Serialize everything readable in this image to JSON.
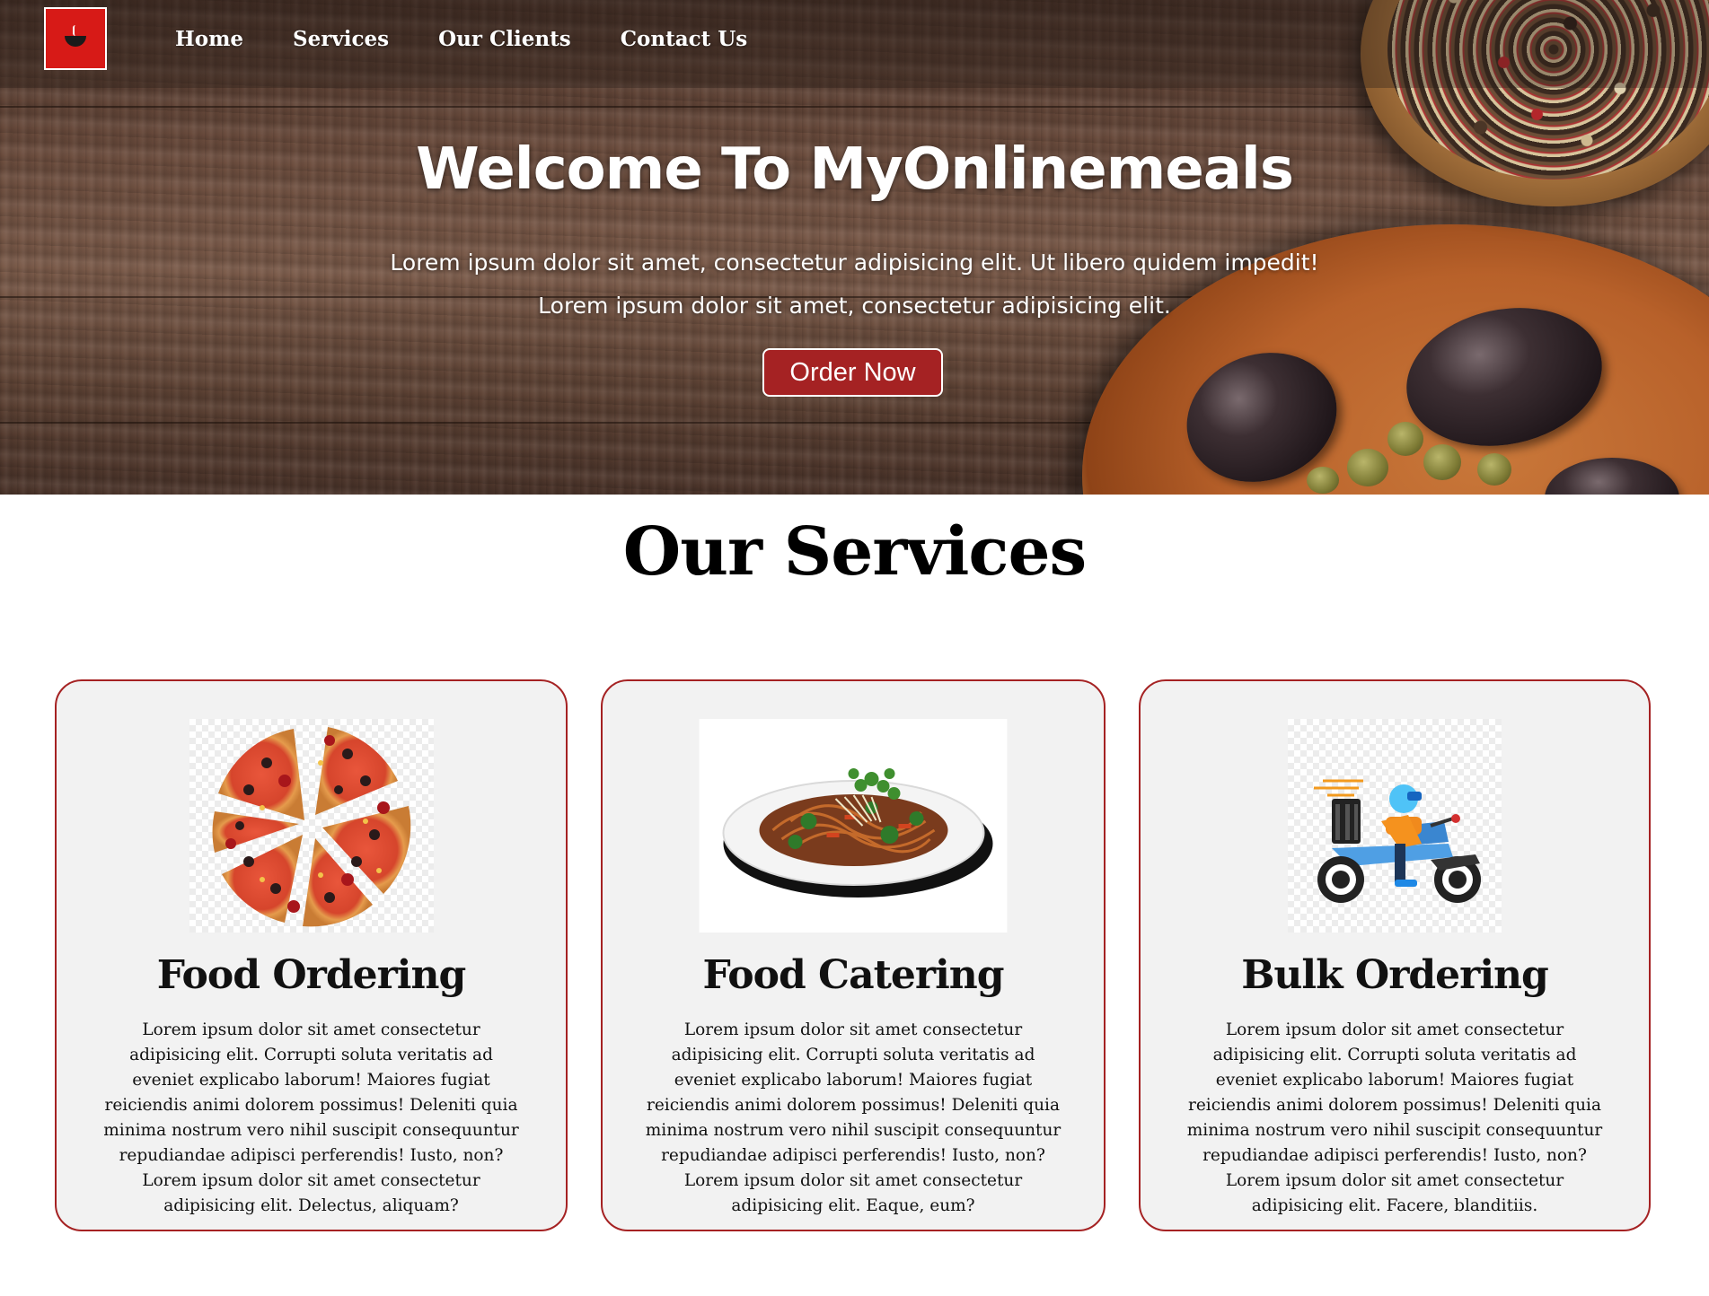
{
  "header": {
    "logo_alt": "MyOnlinemeals logo",
    "nav": [
      {
        "label": "Home"
      },
      {
        "label": "Services"
      },
      {
        "label": "Our Clients"
      },
      {
        "label": "Contact Us"
      }
    ]
  },
  "hero": {
    "title": "Welcome To MyOnlinemeals",
    "subtitle_line1": "Lorem ipsum dolor sit amet, consectetur adipisicing elit. Ut libero quidem impedit!",
    "subtitle_line2": "Lorem ipsum dolor sit amet, consectetur adipisicing elit.",
    "cta_label": "Order Now"
  },
  "services": {
    "title": "Our Services",
    "cards": [
      {
        "title": "Food Ordering",
        "image": "pizza-image",
        "text": "Lorem ipsum dolor sit amet consectetur adipisicing elit. Corrupti soluta veritatis ad eveniet explicabo laborum! Maiores fugiat reiciendis animi dolorem possimus! Deleniti quia minima nostrum vero nihil suscipit consequuntur repudiandae adipisci perferendis! Iusto, non? Lorem ipsum dolor sit amet consectetur adipisicing elit. Delectus, aliquam?"
      },
      {
        "title": "Food Catering",
        "image": "noodle-plate-image",
        "text": "Lorem ipsum dolor sit amet consectetur adipisicing elit. Corrupti soluta veritatis ad eveniet explicabo laborum! Maiores fugiat reiciendis animi dolorem possimus! Deleniti quia minima nostrum vero nihil suscipit consequuntur repudiandae adipisci perferendis! Iusto, non? Lorem ipsum dolor sit amet consectetur adipisicing elit. Eaque, eum?"
      },
      {
        "title": "Bulk Ordering",
        "image": "delivery-scooter-image",
        "text": "Lorem ipsum dolor sit amet consectetur adipisicing elit. Corrupti soluta veritatis ad eveniet explicabo laborum! Maiores fugiat reiciendis animi dolorem possimus! Deleniti quia minima nostrum vero nihil suscipit consequuntur repudiandae adipisci perferendis! Iusto, non? Lorem ipsum dolor sit amet consectetur adipisicing elit. Facere, blanditiis."
      }
    ]
  },
  "colors": {
    "accent": "#a52223",
    "logo_bg": "#d71a17",
    "card_bg": "#f2f2f2"
  }
}
